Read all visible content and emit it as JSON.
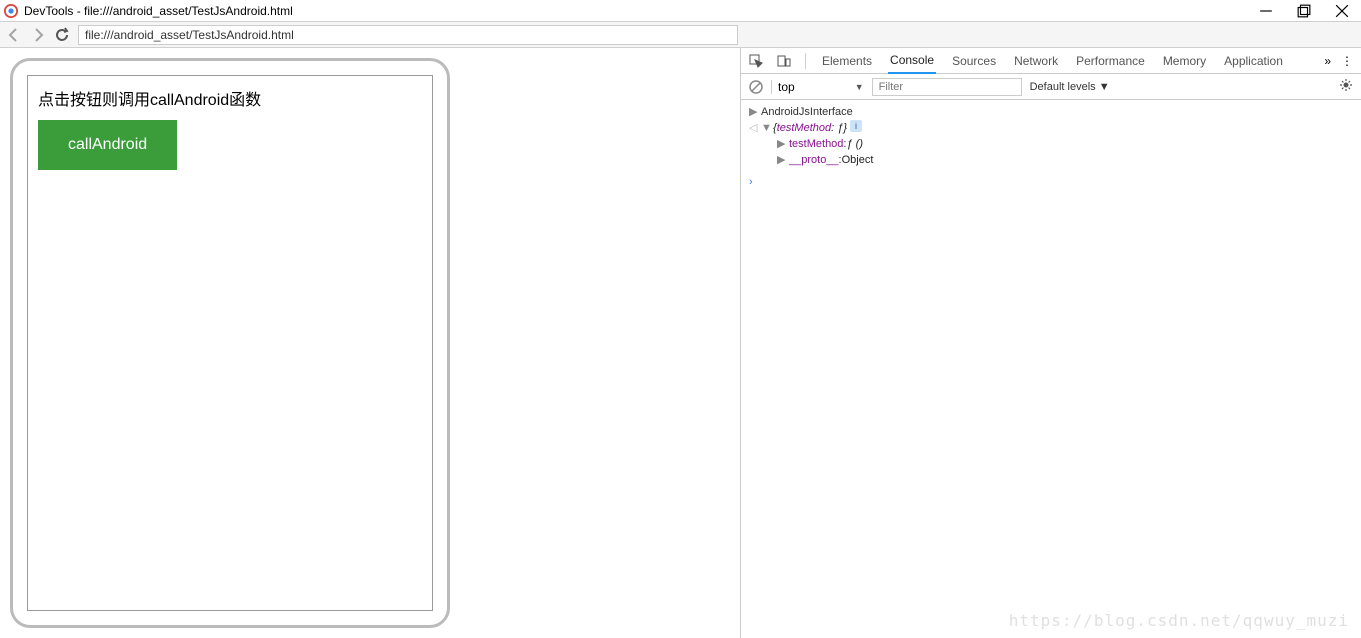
{
  "titlebar": {
    "title": "DevTools - file:///android_asset/TestJsAndroid.html"
  },
  "nav": {
    "url": "file:///android_asset/TestJsAndroid.html"
  },
  "page": {
    "heading": "点击按钮则调用callAndroid函数",
    "button_label": "callAndroid"
  },
  "devtools": {
    "tabs": [
      "Elements",
      "Console",
      "Sources",
      "Network",
      "Performance",
      "Memory",
      "Application"
    ],
    "active_tab": "Console",
    "context": "top",
    "filter_placeholder": "Filter",
    "levels": "Default levels ▼"
  },
  "console": {
    "line1": "AndroidJsInterface",
    "obj_preview_open": "{",
    "obj_preview_key": "testMethod",
    "obj_preview_val": "ƒ",
    "obj_preview_close": "}",
    "prop1_key": "testMethod",
    "prop1_val": "ƒ ()",
    "proto_key": "__proto__",
    "proto_val": "Object"
  },
  "watermark": "https://blog.csdn.net/qqwuy_muzi"
}
